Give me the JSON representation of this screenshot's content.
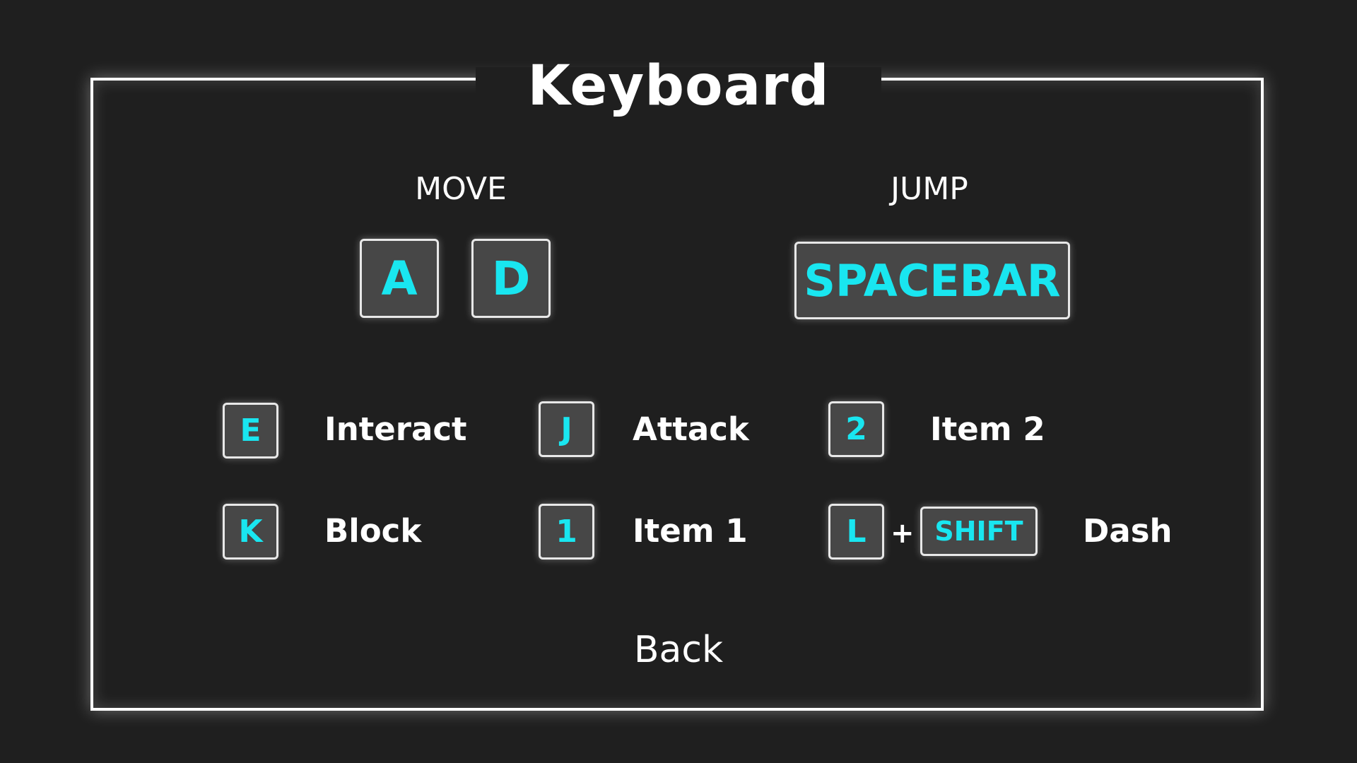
{
  "title": "Keyboard",
  "sections": {
    "move": {
      "label": "MOVE",
      "keys": [
        "A",
        "D"
      ]
    },
    "jump": {
      "label": "JUMP",
      "key": "SPACEBAR"
    }
  },
  "bindings": [
    {
      "key": "E",
      "action": "Interact"
    },
    {
      "key": "J",
      "action": "Attack"
    },
    {
      "key": "2",
      "action": "Item 2"
    },
    {
      "key": "K",
      "action": "Block"
    },
    {
      "key": "1",
      "action": "Item 1"
    },
    {
      "key": "L",
      "modifier": "SHIFT",
      "plus": "+",
      "action": "Dash"
    }
  ],
  "back_label": "Back",
  "colors": {
    "background": "#1f1f1f",
    "key_text": "#19e6f0",
    "key_fill": "#474747",
    "frame": "#ffffff"
  }
}
